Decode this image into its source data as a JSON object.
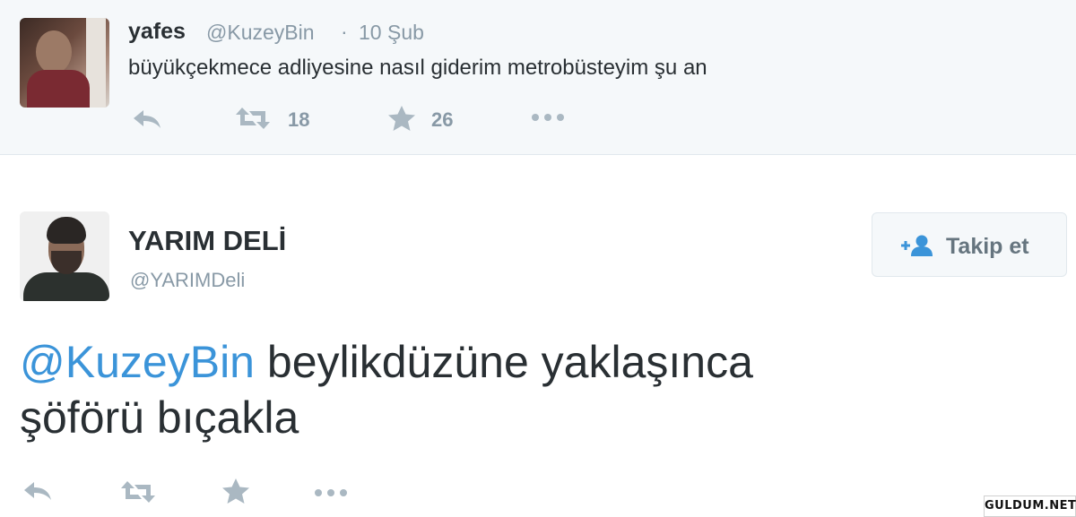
{
  "reply_tweet": {
    "name": "yafes",
    "handle": "@KuzeyBin",
    "separator": "·",
    "date": "10 Şub",
    "text": "büyükçekmece adliyesine nasıl giderim metrobüsteyim şu an",
    "retweet_count": "18",
    "favorite_count": "26",
    "icons": [
      "reply-icon",
      "retweet-icon",
      "favorite-icon",
      "more-icon"
    ]
  },
  "main_tweet": {
    "name": "YARIM DELİ",
    "handle": "@YARIMDeli",
    "follow_label": "Takip et",
    "mention": "@KuzeyBin",
    "text_after_mention": " beylikdüzüne yaklaşınca",
    "text_line2": "şöförü bıçakla",
    "icons": [
      "reply-icon",
      "retweet-icon",
      "favorite-icon",
      "more-icon"
    ]
  },
  "watermark": "GULDUM.NET",
  "colors": {
    "background": "#ffffff",
    "reply_background": "#f5f8fa",
    "text": "#292f33",
    "secondary_text": "#8899a6",
    "mention": "#3b94d9",
    "icon": "#aab8c2"
  }
}
